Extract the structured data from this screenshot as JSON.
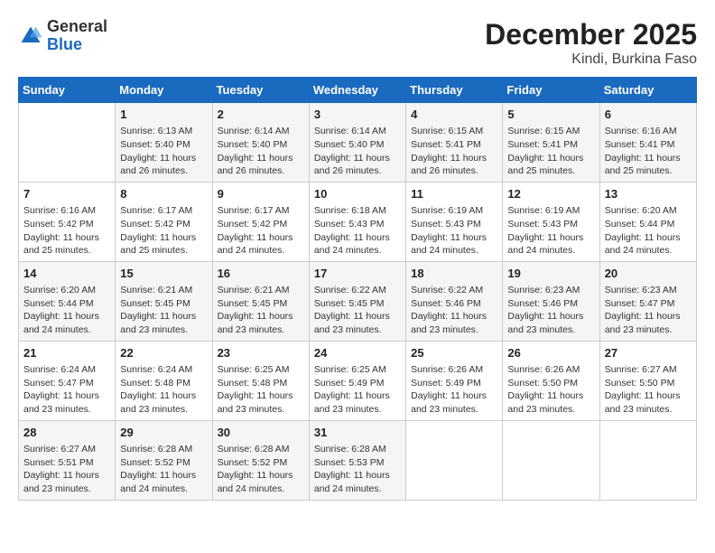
{
  "header": {
    "logo_general": "General",
    "logo_blue": "Blue",
    "title": "December 2025",
    "subtitle": "Kindi, Burkina Faso"
  },
  "weekdays": [
    "Sunday",
    "Monday",
    "Tuesday",
    "Wednesday",
    "Thursday",
    "Friday",
    "Saturday"
  ],
  "weeks": [
    [
      {
        "day": "",
        "info": ""
      },
      {
        "day": "1",
        "info": "Sunrise: 6:13 AM\nSunset: 5:40 PM\nDaylight: 11 hours and 26 minutes."
      },
      {
        "day": "2",
        "info": "Sunrise: 6:14 AM\nSunset: 5:40 PM\nDaylight: 11 hours and 26 minutes."
      },
      {
        "day": "3",
        "info": "Sunrise: 6:14 AM\nSunset: 5:40 PM\nDaylight: 11 hours and 26 minutes."
      },
      {
        "day": "4",
        "info": "Sunrise: 6:15 AM\nSunset: 5:41 PM\nDaylight: 11 hours and 26 minutes."
      },
      {
        "day": "5",
        "info": "Sunrise: 6:15 AM\nSunset: 5:41 PM\nDaylight: 11 hours and 25 minutes."
      },
      {
        "day": "6",
        "info": "Sunrise: 6:16 AM\nSunset: 5:41 PM\nDaylight: 11 hours and 25 minutes."
      }
    ],
    [
      {
        "day": "7",
        "info": "Sunrise: 6:16 AM\nSunset: 5:42 PM\nDaylight: 11 hours and 25 minutes."
      },
      {
        "day": "8",
        "info": "Sunrise: 6:17 AM\nSunset: 5:42 PM\nDaylight: 11 hours and 25 minutes."
      },
      {
        "day": "9",
        "info": "Sunrise: 6:17 AM\nSunset: 5:42 PM\nDaylight: 11 hours and 24 minutes."
      },
      {
        "day": "10",
        "info": "Sunrise: 6:18 AM\nSunset: 5:43 PM\nDaylight: 11 hours and 24 minutes."
      },
      {
        "day": "11",
        "info": "Sunrise: 6:19 AM\nSunset: 5:43 PM\nDaylight: 11 hours and 24 minutes."
      },
      {
        "day": "12",
        "info": "Sunrise: 6:19 AM\nSunset: 5:43 PM\nDaylight: 11 hours and 24 minutes."
      },
      {
        "day": "13",
        "info": "Sunrise: 6:20 AM\nSunset: 5:44 PM\nDaylight: 11 hours and 24 minutes."
      }
    ],
    [
      {
        "day": "14",
        "info": "Sunrise: 6:20 AM\nSunset: 5:44 PM\nDaylight: 11 hours and 24 minutes."
      },
      {
        "day": "15",
        "info": "Sunrise: 6:21 AM\nSunset: 5:45 PM\nDaylight: 11 hours and 23 minutes."
      },
      {
        "day": "16",
        "info": "Sunrise: 6:21 AM\nSunset: 5:45 PM\nDaylight: 11 hours and 23 minutes."
      },
      {
        "day": "17",
        "info": "Sunrise: 6:22 AM\nSunset: 5:45 PM\nDaylight: 11 hours and 23 minutes."
      },
      {
        "day": "18",
        "info": "Sunrise: 6:22 AM\nSunset: 5:46 PM\nDaylight: 11 hours and 23 minutes."
      },
      {
        "day": "19",
        "info": "Sunrise: 6:23 AM\nSunset: 5:46 PM\nDaylight: 11 hours and 23 minutes."
      },
      {
        "day": "20",
        "info": "Sunrise: 6:23 AM\nSunset: 5:47 PM\nDaylight: 11 hours and 23 minutes."
      }
    ],
    [
      {
        "day": "21",
        "info": "Sunrise: 6:24 AM\nSunset: 5:47 PM\nDaylight: 11 hours and 23 minutes."
      },
      {
        "day": "22",
        "info": "Sunrise: 6:24 AM\nSunset: 5:48 PM\nDaylight: 11 hours and 23 minutes."
      },
      {
        "day": "23",
        "info": "Sunrise: 6:25 AM\nSunset: 5:48 PM\nDaylight: 11 hours and 23 minutes."
      },
      {
        "day": "24",
        "info": "Sunrise: 6:25 AM\nSunset: 5:49 PM\nDaylight: 11 hours and 23 minutes."
      },
      {
        "day": "25",
        "info": "Sunrise: 6:26 AM\nSunset: 5:49 PM\nDaylight: 11 hours and 23 minutes."
      },
      {
        "day": "26",
        "info": "Sunrise: 6:26 AM\nSunset: 5:50 PM\nDaylight: 11 hours and 23 minutes."
      },
      {
        "day": "27",
        "info": "Sunrise: 6:27 AM\nSunset: 5:50 PM\nDaylight: 11 hours and 23 minutes."
      }
    ],
    [
      {
        "day": "28",
        "info": "Sunrise: 6:27 AM\nSunset: 5:51 PM\nDaylight: 11 hours and 23 minutes."
      },
      {
        "day": "29",
        "info": "Sunrise: 6:28 AM\nSunset: 5:52 PM\nDaylight: 11 hours and 24 minutes."
      },
      {
        "day": "30",
        "info": "Sunrise: 6:28 AM\nSunset: 5:52 PM\nDaylight: 11 hours and 24 minutes."
      },
      {
        "day": "31",
        "info": "Sunrise: 6:28 AM\nSunset: 5:53 PM\nDaylight: 11 hours and 24 minutes."
      },
      {
        "day": "",
        "info": ""
      },
      {
        "day": "",
        "info": ""
      },
      {
        "day": "",
        "info": ""
      }
    ]
  ]
}
